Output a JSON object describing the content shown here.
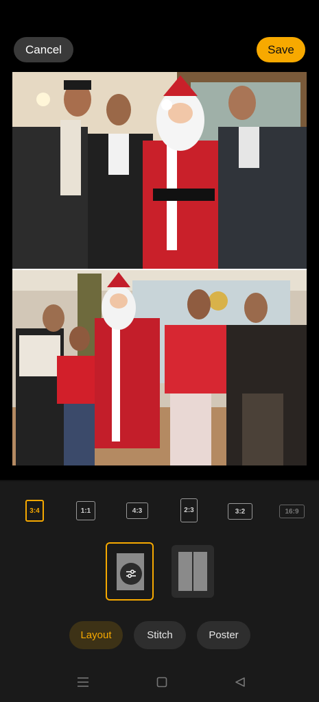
{
  "header": {
    "cancel_label": "Cancel",
    "save_label": "Save"
  },
  "collage": {
    "photos": [
      {
        "name": "photo-group-with-santa-men"
      },
      {
        "name": "photo-group-with-santa-family"
      }
    ]
  },
  "ratios": [
    {
      "label": "3:4",
      "state": "selected"
    },
    {
      "label": "1:1",
      "state": "normal"
    },
    {
      "label": "4:3",
      "state": "normal"
    },
    {
      "label": "2:3",
      "state": "normal"
    },
    {
      "label": "3:2",
      "state": "normal"
    },
    {
      "label": "16:9",
      "state": "disabled"
    }
  ],
  "templates": [
    {
      "name": "single-vertical",
      "selected": true,
      "icon": "adjust-sliders-icon"
    },
    {
      "name": "two-columns",
      "selected": false
    }
  ],
  "modes": [
    {
      "label": "Layout",
      "active": true
    },
    {
      "label": "Stitch",
      "active": false
    },
    {
      "label": "Poster",
      "active": false
    }
  ],
  "navigation": {
    "icons": [
      "menu-icon",
      "home-icon",
      "back-icon"
    ]
  },
  "colors": {
    "accent": "#f7a900",
    "background": "#000000",
    "panel": "#1a1a1a",
    "pill": "#2e2e2e"
  }
}
